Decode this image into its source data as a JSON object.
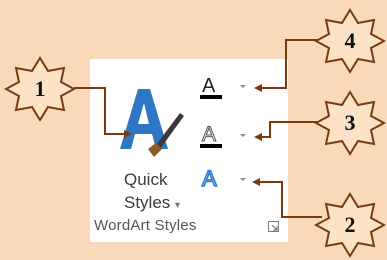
{
  "ribbon": {
    "quick_styles": {
      "line1": "Quick",
      "line2": "Styles",
      "arrow": "▾",
      "icon": "quick-styles-icon"
    },
    "text_fill": {
      "icon": "text-fill-icon",
      "fill_color": "#000000"
    },
    "text_outline": {
      "icon": "text-outline-icon",
      "outline_color": "#000000"
    },
    "text_effects": {
      "icon": "text-effects-icon",
      "glow_color": "#2e7fd0"
    },
    "group_label": "WordArt Styles",
    "launcher_icon": "dialog-launcher-icon"
  },
  "callouts": [
    {
      "label": "1",
      "target": "quick-styles"
    },
    {
      "label": "2",
      "target": "text-effects"
    },
    {
      "label": "3",
      "target": "text-outline"
    },
    {
      "label": "4",
      "target": "text-fill"
    }
  ],
  "colors": {
    "background": "#f8d9b9",
    "leader_line": "#7a3a10",
    "star_fill": "#fce3c8"
  }
}
